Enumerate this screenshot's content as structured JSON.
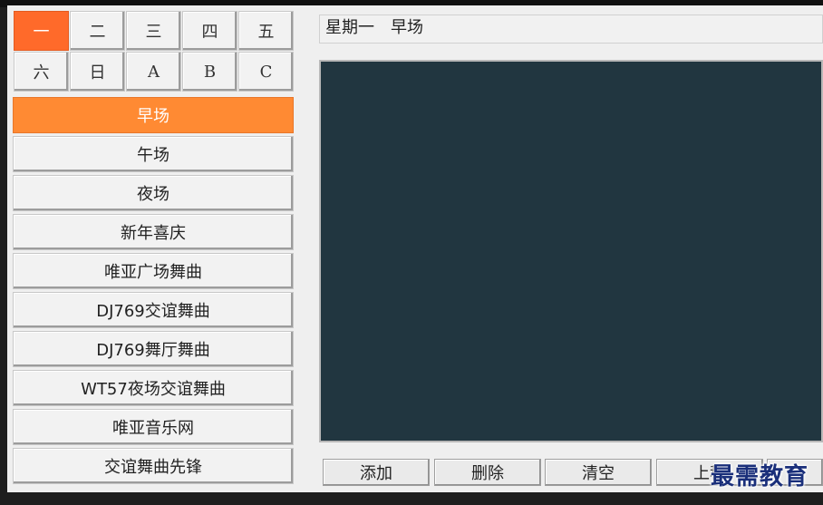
{
  "days": {
    "row1": [
      "一",
      "二",
      "三",
      "四",
      "五"
    ],
    "row2": [
      "六",
      "日",
      "A",
      "B",
      "C"
    ],
    "selected": "一"
  },
  "sessions": [
    "早场",
    "午场",
    "夜场",
    "新年喜庆",
    "唯亚广场舞曲",
    "DJ769交谊舞曲",
    "DJ769舞厅舞曲",
    "WT57夜场交谊舞曲",
    "唯亚音乐网",
    "交谊舞曲先锋"
  ],
  "status": {
    "text": "星期一　早场"
  },
  "actions": [
    "添加",
    "删除",
    "清空",
    "上移"
  ],
  "watermark": "最需教育",
  "colors": {
    "selected_day": "#ff6a2a",
    "selected_session": "#ff8a33",
    "playlist_bg": "#213640"
  }
}
